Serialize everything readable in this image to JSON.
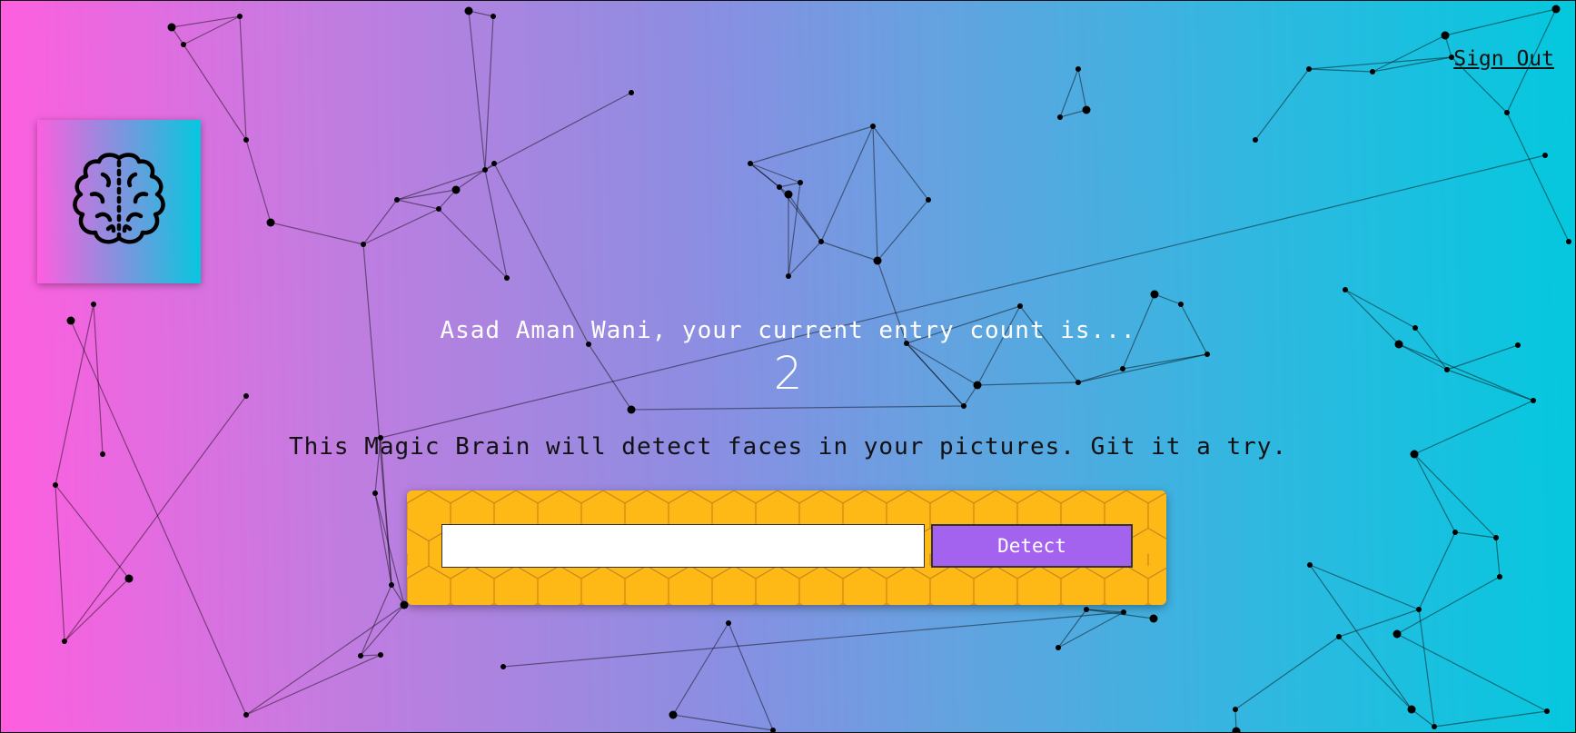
{
  "nav": {
    "sign_out_label": "Sign Out"
  },
  "logo": {
    "icon": "brain-icon"
  },
  "rank": {
    "message": "Asad Aman Wani, your current entry count is...",
    "entries": "2"
  },
  "image_link_form": {
    "description": "This Magic Brain will detect faces in your pictures. Git it a try.",
    "input_value": "",
    "button_label": "Detect"
  },
  "colors": {
    "gradient_start": "#ff5edf",
    "gradient_end": "#04c8de",
    "panel": "#ffb917",
    "button": "#a463ee"
  }
}
